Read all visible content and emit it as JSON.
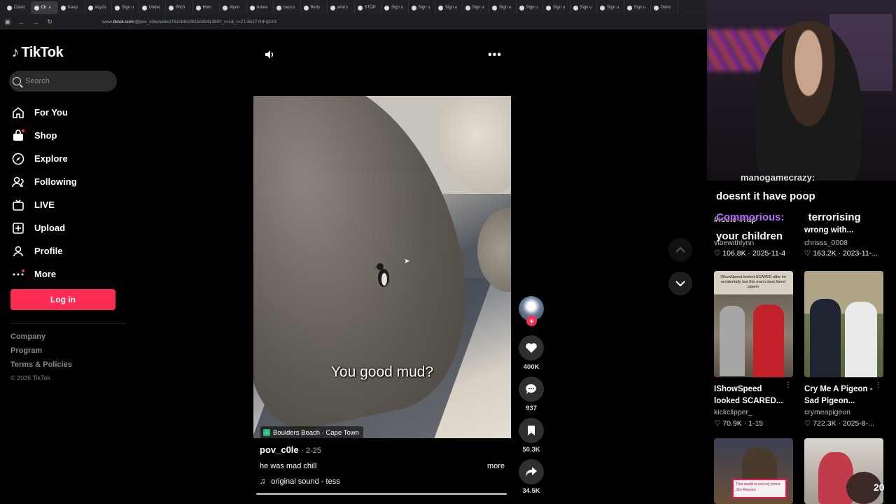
{
  "browser": {
    "tabs": [
      {
        "label": "Clavic"
      },
      {
        "label": "Ch"
      },
      {
        "label": "Keep"
      },
      {
        "label": "#syzb"
      },
      {
        "label": "Sign u"
      },
      {
        "label": "Under"
      },
      {
        "label": "Pitch"
      },
      {
        "label": "Hom"
      },
      {
        "label": "#lynn"
      },
      {
        "label": "Adore"
      },
      {
        "label": "bacco"
      },
      {
        "label": "Betty"
      },
      {
        "label": "who's"
      },
      {
        "label": "STOP"
      },
      {
        "label": "Sign u"
      },
      {
        "label": "Sign u"
      },
      {
        "label": "Sign u"
      },
      {
        "label": "Sign u"
      },
      {
        "label": "Sign u"
      },
      {
        "label": "Sign u"
      },
      {
        "label": "Sign u"
      },
      {
        "label": "Sign u"
      },
      {
        "label": "Sign u"
      },
      {
        "label": "Sign u"
      },
      {
        "label": "Detro"
      }
    ],
    "active_tab": 1,
    "url_prefix": "www.",
    "url_domain": "tiktok.com",
    "url_rest": "/@pov_c0le/video/7610884282503941389?_r=1&_t=ZT-9527YhFq3XX"
  },
  "sidebar": {
    "brand": "TikTok",
    "search_placeholder": "Search",
    "items": [
      {
        "label": "For You",
        "icon": "home-icon"
      },
      {
        "label": "Shop",
        "icon": "shop-icon"
      },
      {
        "label": "Explore",
        "icon": "compass-icon"
      },
      {
        "label": "Following",
        "icon": "following-icon"
      },
      {
        "label": "LIVE",
        "icon": "live-icon"
      },
      {
        "label": "Upload",
        "icon": "upload-icon"
      },
      {
        "label": "Profile",
        "icon": "profile-icon"
      },
      {
        "label": "More",
        "icon": "more-icon"
      }
    ],
    "login_label": "Log in",
    "footer": {
      "company": "Company",
      "program": "Program",
      "terms": "Terms & Policies",
      "copyright": "© 2026 TikTok"
    }
  },
  "video": {
    "overlay_text": "You good mud?",
    "location": "Boulders Beach · Cape Town",
    "author": "pov_c0le",
    "date": "· 2-25",
    "description": "he was mad chill",
    "more_label": "more",
    "sound": "original sound - tess",
    "progress": 1.0
  },
  "actions": {
    "likes": "400K",
    "comments": "937",
    "saves": "50.3K",
    "shares": "34.5K"
  },
  "chat": {
    "line1": "doesnt it have poop",
    "line2_user": "Commorious:",
    "line2_msg": "terrorising",
    "line3": "your children",
    "line0": "manogamecrazy:"
  },
  "related": {
    "row0": [
      {
        "title": "#icole #rap",
        "user": "vibewithlynn",
        "stats": "106.8K · 2025-11-4"
      },
      {
        "title": "wrong with...",
        "user": "chrisss_0008",
        "stats": "163.2K · 2023-11-..."
      }
    ],
    "row1": [
      {
        "title_a": "IShowSpeed",
        "title_b": "looked SCARED...",
        "user": "kickclipper_",
        "stats": "70.9K · 1-15",
        "thumb_caption": "IShowSpeed looked SCARED after he accidentally lost this man's best friend pigeon"
      },
      {
        "title_a": "Cry Me A Pigeon -",
        "title_b": "Sad Pigeon...",
        "user": "crymeapigeon",
        "stats": "722.3K · 2025-8-..."
      }
    ],
    "row2": [
      {
        "thumb_caption_a": "This world is not my home",
        "thumb_caption_b": "Jim Reeves"
      },
      {
        "badge": "20"
      }
    ]
  },
  "colors": {
    "accent": "#fe2c55",
    "background": "#000000"
  }
}
